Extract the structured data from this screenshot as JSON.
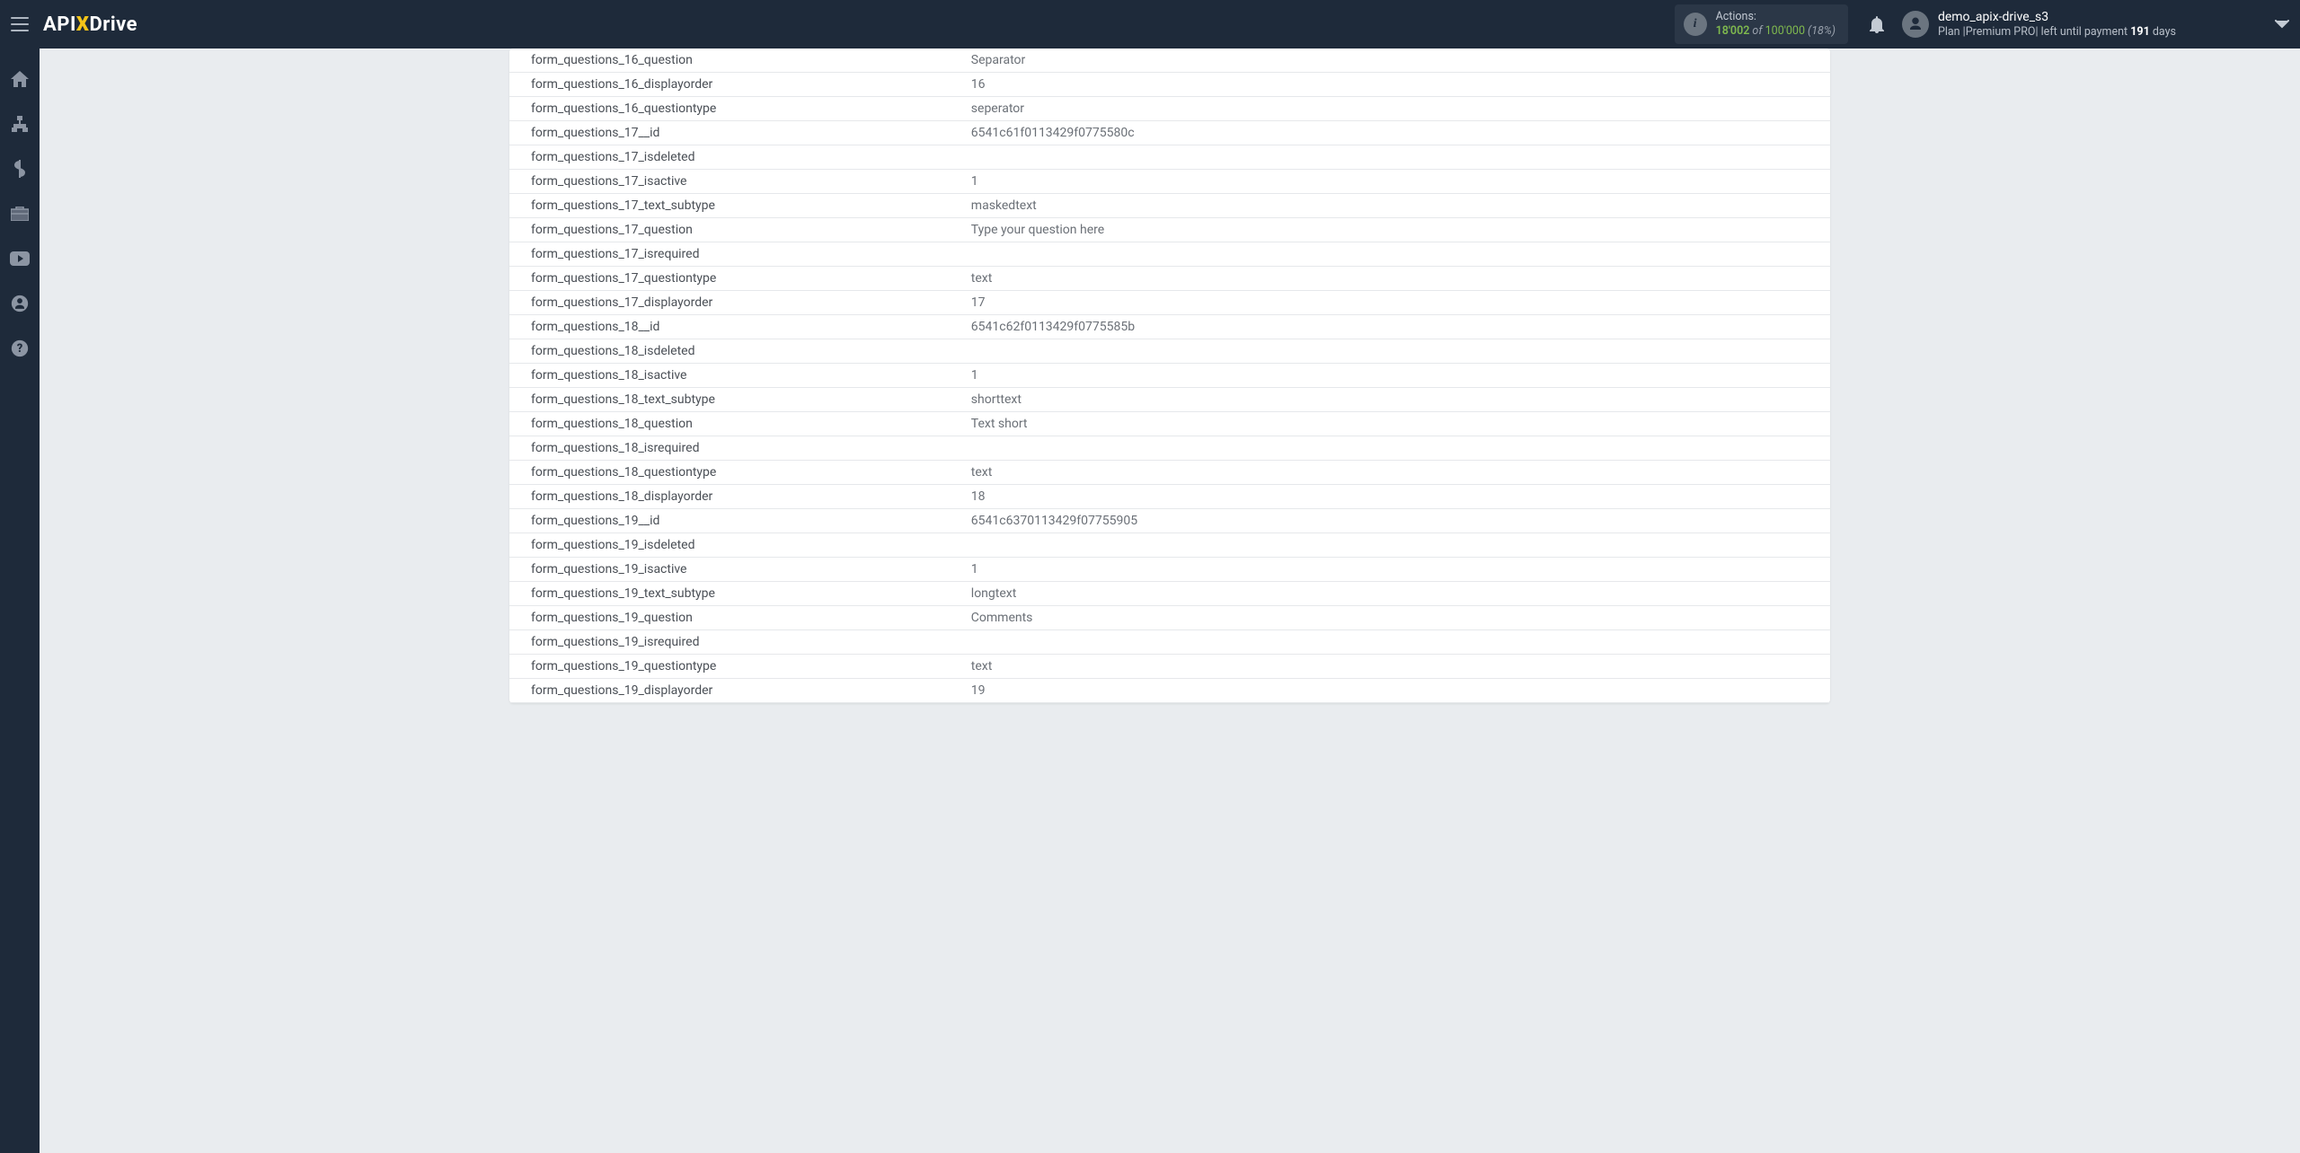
{
  "header": {
    "logo_a": "API",
    "logo_b": "Drive",
    "actions_label": "Actions:",
    "actions_used": "18'002",
    "actions_of": " of ",
    "actions_total": "100'000",
    "actions_pct": " (18%)",
    "user_name": "demo_apix-drive_s3",
    "plan_prefix": "Plan |Premium PRO| left until payment ",
    "plan_days": "191",
    "plan_suffix": " days"
  },
  "rows": [
    {
      "key": "form_questions_16_question",
      "val": "Separator"
    },
    {
      "key": "form_questions_16_displayorder",
      "val": "16"
    },
    {
      "key": "form_questions_16_questiontype",
      "val": "seperator"
    },
    {
      "key": "form_questions_17__id",
      "val": "6541c61f0113429f0775580c"
    },
    {
      "key": "form_questions_17_isdeleted",
      "val": ""
    },
    {
      "key": "form_questions_17_isactive",
      "val": "1"
    },
    {
      "key": "form_questions_17_text_subtype",
      "val": "maskedtext"
    },
    {
      "key": "form_questions_17_question",
      "val": "Type your question here"
    },
    {
      "key": "form_questions_17_isrequired",
      "val": ""
    },
    {
      "key": "form_questions_17_questiontype",
      "val": "text"
    },
    {
      "key": "form_questions_17_displayorder",
      "val": "17"
    },
    {
      "key": "form_questions_18__id",
      "val": "6541c62f0113429f0775585b"
    },
    {
      "key": "form_questions_18_isdeleted",
      "val": ""
    },
    {
      "key": "form_questions_18_isactive",
      "val": "1"
    },
    {
      "key": "form_questions_18_text_subtype",
      "val": "shorttext"
    },
    {
      "key": "form_questions_18_question",
      "val": "Text short"
    },
    {
      "key": "form_questions_18_isrequired",
      "val": ""
    },
    {
      "key": "form_questions_18_questiontype",
      "val": "text"
    },
    {
      "key": "form_questions_18_displayorder",
      "val": "18"
    },
    {
      "key": "form_questions_19__id",
      "val": "6541c6370113429f07755905"
    },
    {
      "key": "form_questions_19_isdeleted",
      "val": ""
    },
    {
      "key": "form_questions_19_isactive",
      "val": "1"
    },
    {
      "key": "form_questions_19_text_subtype",
      "val": "longtext"
    },
    {
      "key": "form_questions_19_question",
      "val": "Comments"
    },
    {
      "key": "form_questions_19_isrequired",
      "val": ""
    },
    {
      "key": "form_questions_19_questiontype",
      "val": "text"
    },
    {
      "key": "form_questions_19_displayorder",
      "val": "19"
    }
  ]
}
